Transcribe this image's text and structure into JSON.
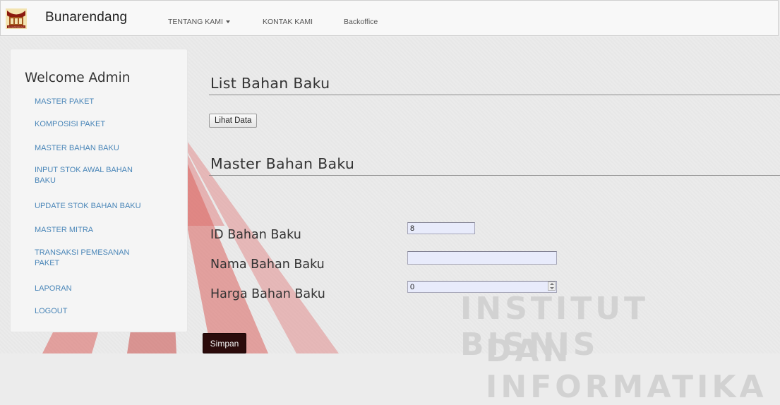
{
  "navbar": {
    "brand": "Bunarendang",
    "logo_caption": "BUNARENDANG",
    "items": [
      {
        "label": "TENTANG KAMI",
        "has_dropdown": true
      },
      {
        "label": "KONTAK KAMI"
      },
      {
        "label": "Backoffice"
      }
    ]
  },
  "sidebar": {
    "welcome": "Welcome Admin",
    "items": [
      {
        "label": "MASTER PAKET"
      },
      {
        "label": "KOMPOSISI PAKET"
      },
      {
        "label": "MASTER BAHAN BAKU"
      },
      {
        "label": "INPUT STOK AWAL BAHAN BAKU"
      },
      {
        "label": "UPDATE STOK BAHAN BAKU"
      },
      {
        "label": "MASTER MITRA"
      },
      {
        "label": "TRANSAKSI PEMESANAN PAKET"
      },
      {
        "label": "LAPORAN"
      },
      {
        "label": "LOGOUT"
      }
    ]
  },
  "main": {
    "list_title": "List Bahan Baku",
    "view_button": "Lihat Data",
    "form_title": "Master Bahan Baku",
    "fields": {
      "id": {
        "label": "ID Bahan Baku",
        "value": "8"
      },
      "name": {
        "label": "Nama Bahan Baku",
        "value": ""
      },
      "price": {
        "label": "Harga Bahan Baku",
        "value": "0"
      }
    },
    "submit_button": "Simpan"
  },
  "watermark": {
    "line1": "INSTITUT BISNIS",
    "line2": "DAN INFORMATIKA"
  },
  "colors": {
    "link": "#4a86b8",
    "submit_bg": "#2b0b0b",
    "input_bg": "#e8ebfb",
    "watermark_red": "#d9534f"
  }
}
